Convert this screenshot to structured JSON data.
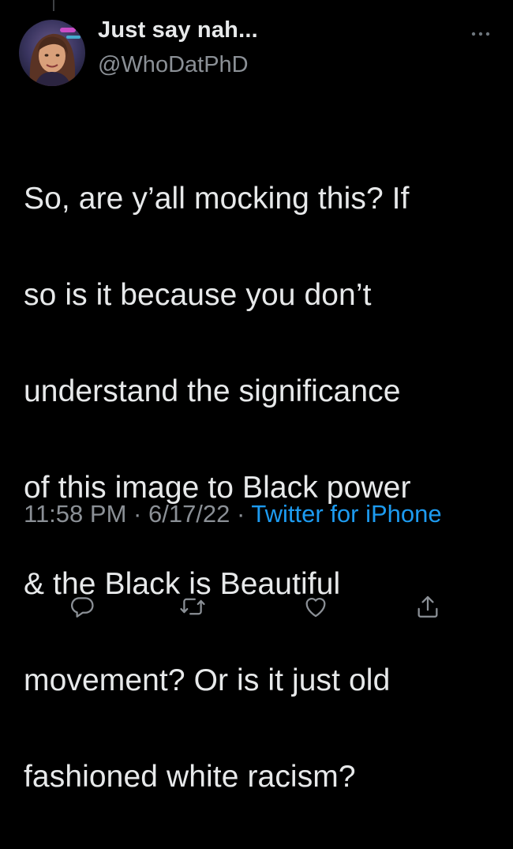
{
  "tweet": {
    "display_name": "Just say nah...",
    "handle": "@WhoDatPhD",
    "text_lines": [
      "So, are y’all mocking this? If",
      "so is it because you don’t",
      "understand the significance",
      "of this image to Black power",
      "& the Black is Beautiful",
      "movement? Or is it just old",
      "fashioned white racism?"
    ],
    "time": "11:58 PM",
    "separator": "·",
    "date": "6/17/22",
    "source": "Twitter for iPhone"
  },
  "icons": {
    "more": "more-horizontal-icon",
    "reply": "reply-icon",
    "retweet": "retweet-icon",
    "like": "like-icon",
    "share": "share-icon"
  },
  "colors": {
    "background": "#000000",
    "text_primary": "#e7e9ea",
    "text_secondary": "#8b9096",
    "link": "#1d9bf0"
  }
}
